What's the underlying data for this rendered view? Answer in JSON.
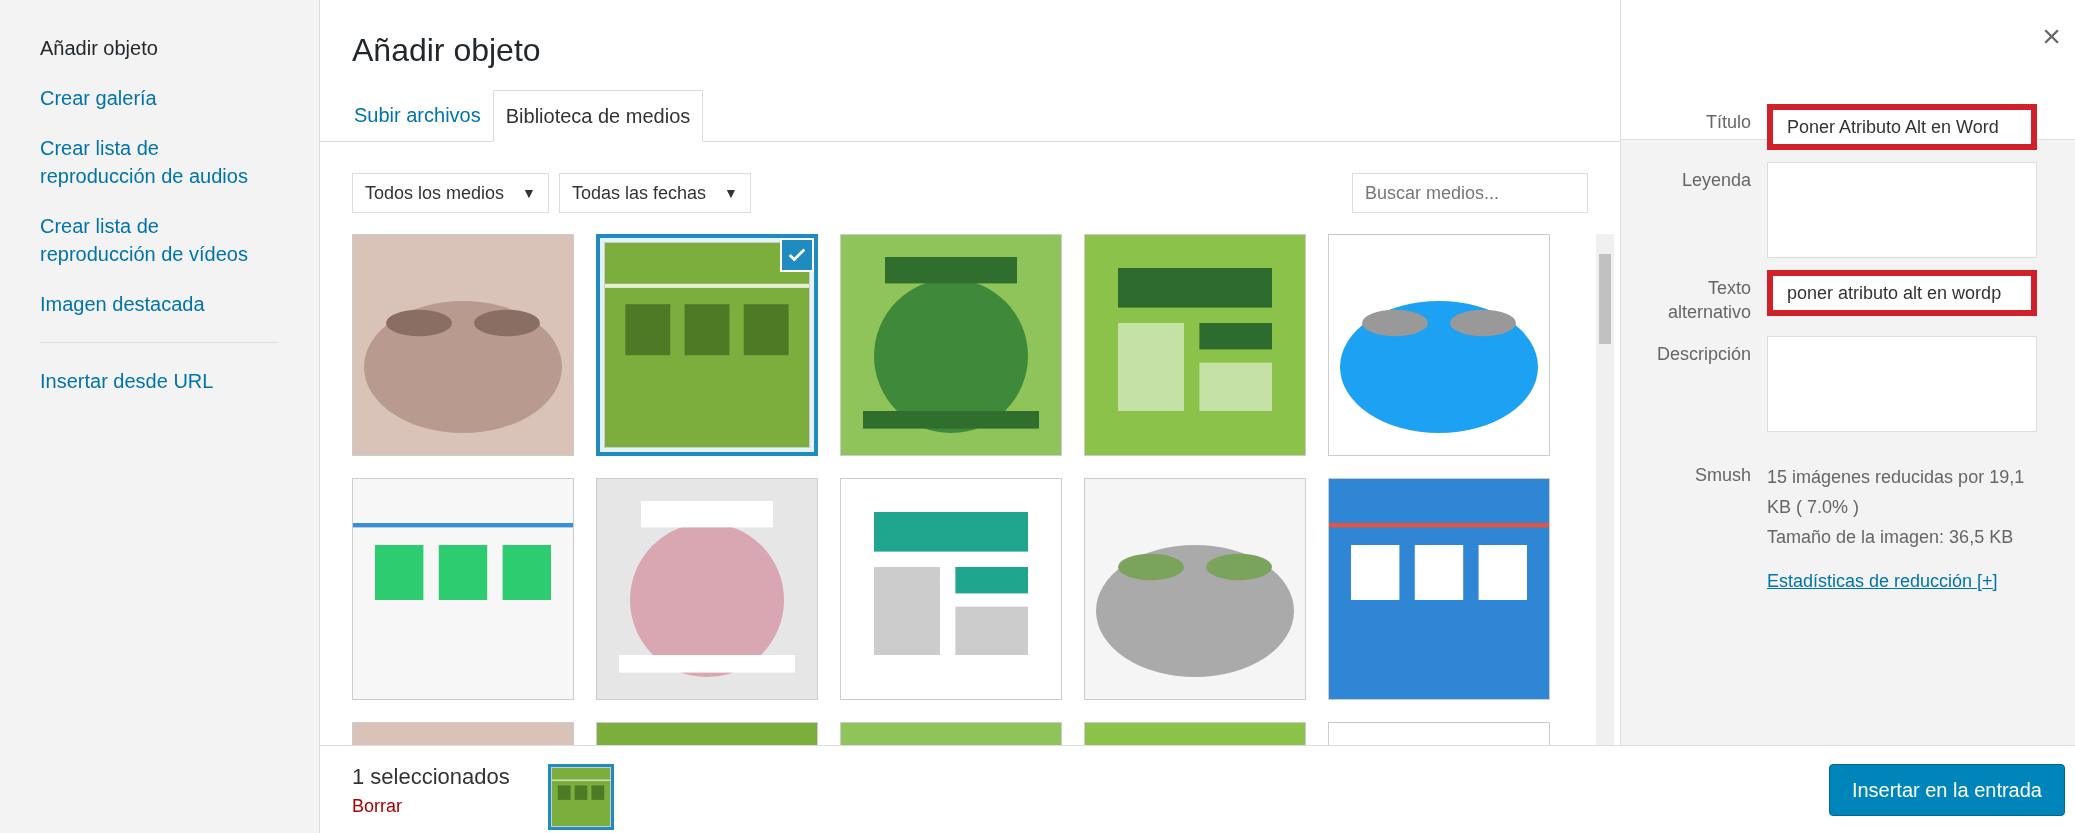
{
  "sidebar": {
    "items": [
      {
        "label": "Añadir objeto",
        "selected": true
      },
      {
        "label": "Crear galería",
        "selected": false
      },
      {
        "label": "Crear lista de reproducción de audios",
        "selected": false
      },
      {
        "label": "Crear lista de reproducción de vídeos",
        "selected": false
      },
      {
        "label": "Imagen destacada",
        "selected": false
      }
    ],
    "extra_items": [
      {
        "label": "Insertar desde URL",
        "selected": false
      }
    ]
  },
  "title": "Añadir objeto",
  "close": "×",
  "tabs": [
    {
      "label": "Subir archivos",
      "selected": false
    },
    {
      "label": "Biblioteca de medios",
      "selected": true
    }
  ],
  "filters": [
    {
      "value": "Todos los medios",
      "caret": "▼"
    },
    {
      "value": "Todas las fechas",
      "caret": "▼"
    }
  ],
  "search": {
    "placeholder": "Buscar medios..."
  },
  "media": [
    {
      "kind": "picture",
      "selected": false
    },
    {
      "kind": "picture",
      "selected": true
    },
    {
      "kind": "picture",
      "selected": false
    },
    {
      "kind": "picture",
      "selected": false
    },
    {
      "kind": "picture",
      "selected": false
    },
    {
      "kind": "picture",
      "selected": false
    },
    {
      "kind": "picture",
      "selected": false
    },
    {
      "kind": "picture",
      "selected": false
    },
    {
      "kind": "picture",
      "selected": false
    },
    {
      "kind": "picture",
      "selected": false
    },
    {
      "kind": "picture",
      "selected": false
    },
    {
      "kind": "picture",
      "selected": false
    },
    {
      "kind": "picture",
      "selected": false
    },
    {
      "kind": "picture",
      "selected": false
    },
    {
      "kind": "picture",
      "selected": false
    }
  ],
  "details": {
    "fields": [
      {
        "label": "Título",
        "kind": "input",
        "value": "Poner Atributo Alt en Word",
        "highlighted": true
      },
      {
        "label": "Leyenda",
        "kind": "textarea",
        "highlighted": false
      },
      {
        "label": "Texto alternativo",
        "kind": "input",
        "value": "poner atributo alt en wordp",
        "highlighted": true
      },
      {
        "label": "Descripción",
        "kind": "textarea",
        "highlighted": false
      }
    ],
    "smush": {
      "label": "Smush",
      "lines": [
        "15 imágenes reducidas por 19,1 KB ( 7.0% )",
        "Tamaño de la imagen: 36,5 KB"
      ],
      "link": "Estadísticas de reducción [+]"
    }
  },
  "footer": {
    "count": "1 seleccionados",
    "clear": "Borrar",
    "button": "Insertar en la entrada"
  }
}
